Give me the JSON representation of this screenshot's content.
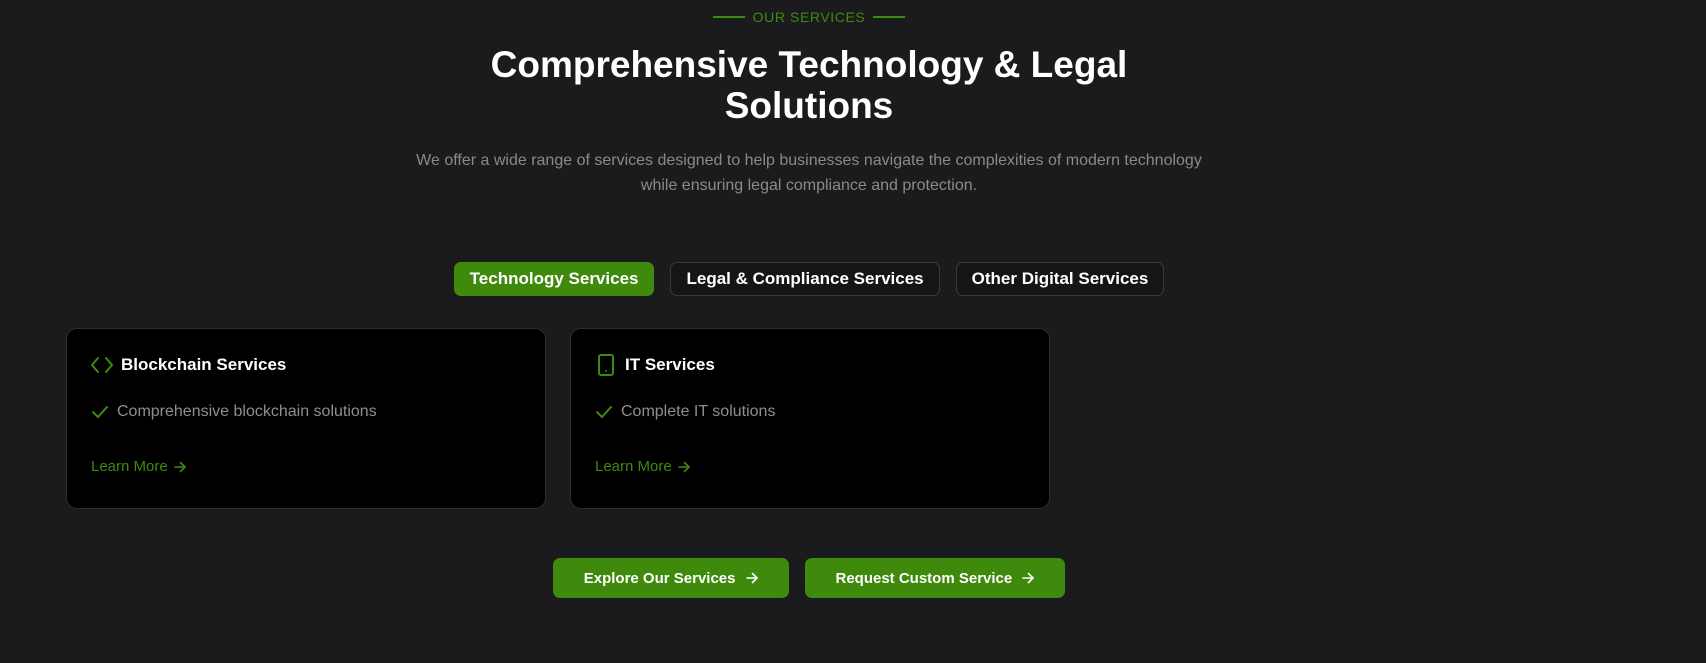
{
  "section": {
    "eyebrow": "OUR SERVICES",
    "title": "Comprehensive Technology & Legal Solutions",
    "subtitle": "We offer a wide range of services designed to help businesses navigate the complexities of modern technology while ensuring legal compliance and protection."
  },
  "tabs": [
    {
      "label": "Technology Services",
      "active": true
    },
    {
      "label": "Legal & Compliance Services",
      "active": false
    },
    {
      "label": "Other Digital Services",
      "active": false
    }
  ],
  "cards": [
    {
      "icon": "code-icon",
      "title": "Blockchain Services",
      "feature": "Comprehensive blockchain solutions",
      "link": "Learn More"
    },
    {
      "icon": "smartphone-icon",
      "title": "IT Services",
      "feature": "Complete IT solutions",
      "link": "Learn More"
    }
  ],
  "cta": {
    "explore_label": "Explore Our Services",
    "request_label": "Request Custom Service"
  },
  "colors": {
    "accent": "#3f8a0d",
    "background": "#1b1b1d",
    "card": "#000000",
    "muted_text": "#8a8a8a"
  }
}
